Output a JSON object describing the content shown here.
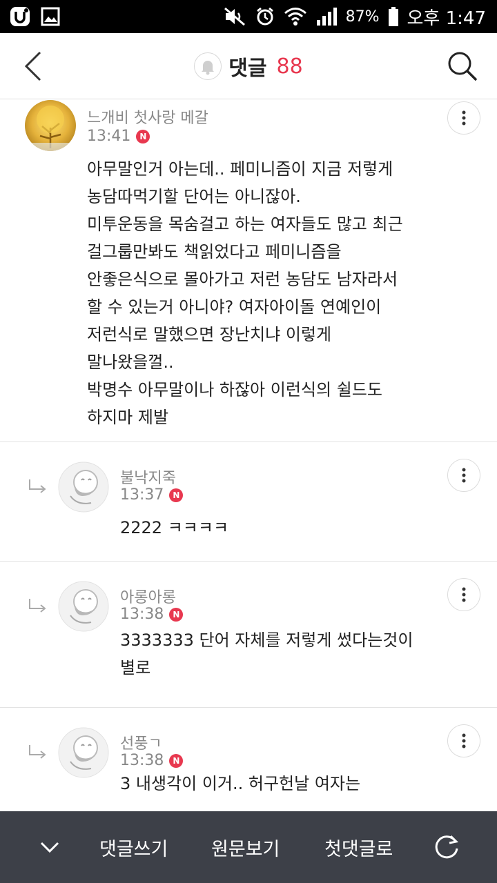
{
  "status_bar": {
    "battery_percent": "87%",
    "time": "오후 1:47",
    "icons": [
      "app-u-icon",
      "image-icon",
      "mute-icon",
      "alarm-icon",
      "wifi-icon",
      "signal-icon",
      "battery-icon"
    ]
  },
  "header": {
    "title": "댓글",
    "count": "88",
    "accent_color": "#e8384f",
    "icons": [
      "back-icon",
      "bell-icon",
      "search-icon"
    ]
  },
  "comments": [
    {
      "nickname": "느개비 첫사랑 메갈",
      "time": "13:41",
      "badge": "N",
      "text": "아무말인거 아는데.. 페미니즘이 지금 저렇게\n농담따먹기할 단어는 아니잖아.\n미투운동을 목숨걸고 하는 여자들도 많고 최근\n걸그룹만봐도 책읽었다고 페미니즘을\n안좋은식으로 몰아가고 저런 농담도 남자라서\n할 수 있는거 아니야? 여자아이돌 연예인이\n저런식로 말했으면 장난치냐 이렇게\n말나왔을껄..\n박명수 아무말이나 하잖아 이런식의 쉴드도\n하지마 제발"
    }
  ],
  "replies": [
    {
      "nickname": "불낙지죽",
      "time": "13:37",
      "badge": "N",
      "text": "2222 ㅋㅋㅋㅋ"
    },
    {
      "nickname": "아롱아롱",
      "time": "13:38",
      "badge": "N",
      "text": "3333333 단어 자체를 저렇게 썼다는것이\n별로"
    },
    {
      "nickname": "선풍ㄱ",
      "time": "13:38",
      "badge": "N",
      "text": "3 내생각이 이거.. 허구헌날 여자는"
    }
  ],
  "bottom_bar": {
    "write": "댓글쓰기",
    "original": "원문보기",
    "first": "첫댓글로",
    "icons": [
      "chevron-down-icon",
      "refresh-icon"
    ]
  }
}
